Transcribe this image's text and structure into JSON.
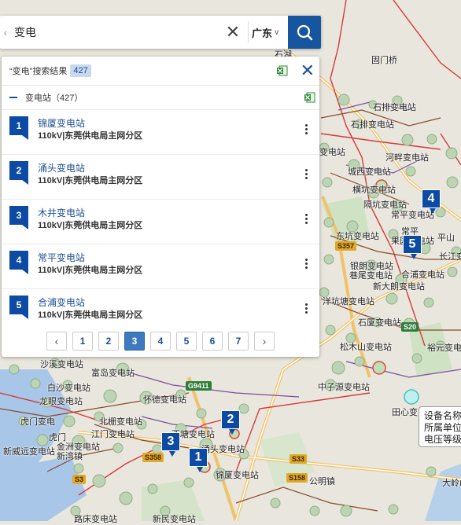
{
  "search": {
    "back_glyph": "‹",
    "query": "变电",
    "clear_glyph": "✕",
    "region": "广东",
    "region_chevron": "∨"
  },
  "results": {
    "title": "“变电”搜索结果",
    "count": "427",
    "close_glyph": "✕",
    "group_label": "变电站（427）",
    "items": [
      {
        "index": "1",
        "name": "锦厦变电站",
        "sub": "110kV|东莞供电局主网分区"
      },
      {
        "index": "2",
        "name": "涌头变电站",
        "sub": "110kV|东莞供电局主网分区"
      },
      {
        "index": "3",
        "name": "木井变电站",
        "sub": "110kV|东莞供电局主网分区"
      },
      {
        "index": "4",
        "name": "常平变电站",
        "sub": "110kV|东莞供电局主网分区"
      },
      {
        "index": "5",
        "name": "合浦变电站",
        "sub": "110kV|东莞供电局主网分区"
      }
    ],
    "pager": {
      "prev": "‹",
      "pages": [
        "1",
        "2",
        "3",
        "4",
        "5",
        "6",
        "7"
      ],
      "active": "3",
      "next": "›"
    }
  },
  "map": {
    "markers": [
      "1",
      "2",
      "3",
      "4",
      "5"
    ],
    "labels": [
      "石湖",
      "固门桥",
      "石排变电站",
      "石排变电站",
      "河畔变电站",
      "变电站",
      "城西变电站",
      "横坑变电站",
      "隔坑变电站",
      "常平变电站",
      "东坑变电站",
      "果园变电站",
      "银朗变电站",
      "巷尾变电站",
      "合浦变电站",
      "新大朗变电站",
      "长江变",
      "洋坑塘变电站",
      "石厦变电站",
      "松木山变电站",
      "裕元变电",
      "中子源变电站",
      "沙溪变电站",
      "富岛变电站",
      "白沙变电站",
      "龙眼变电站",
      "虎门变电",
      "北栅变电站",
      "怀德变电站",
      "江门变电站",
      "金洲变电站",
      "新威远变电站",
      "西塘变电站",
      "涌头变电站",
      "锦厦变电站",
      "田心变电",
      "新湾镇",
      "公明镇",
      "大岭山",
      "新民变电站",
      "路床变电站",
      "虎门",
      "平山",
      "常平"
    ],
    "shields": [
      "G9411",
      "S357",
      "S358",
      "S33",
      "S158",
      "S20",
      "S3"
    ],
    "colors": {
      "marker": "#0c4aa3",
      "search_button": "#17559e",
      "accent": "#1c4f92"
    }
  },
  "infobox": {
    "line1": "设备名称",
    "line2": "所属单位",
    "line3": "电压等级"
  }
}
